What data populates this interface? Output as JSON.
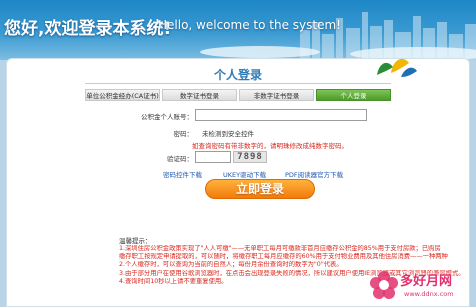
{
  "header": {
    "welcome_cn": "您好,欢迎登录本系统!",
    "welcome_en": "Hello, welcome to the system!"
  },
  "panel": {
    "title": "个人登录",
    "tabs": [
      {
        "label": "单位公积金经办(CA证书)",
        "active": false
      },
      {
        "label": "数字证书登录",
        "active": false
      },
      {
        "label": "非数字证书登录",
        "active": false
      },
      {
        "label": "个人登录",
        "active": true
      }
    ]
  },
  "form": {
    "account_label": "公积金个人账号：",
    "account_value": "",
    "password_label": "密码：",
    "password_value": "未检测到安全控件",
    "warning": "如查询密码有带非数字的，请明珠修改成纯数字密码。",
    "captcha_label": "验证码：",
    "captcha_value": "",
    "captcha_code": "7898",
    "login_button": "立即登录"
  },
  "downloads": [
    "密码控件下载",
    "UKEY驱动下载",
    "PDF阅读器官方下载"
  ],
  "tips": {
    "title": "温馨提示：",
    "lines": [
      "1.深圳住房公积金政策实现了\"人人可缴\"——无单职工每月可缴款非首月应缴存公积金的85%用于支付房款；已购房",
      "缴存职工按规定申请提取的，可以随时，将缴存职工每月应缴存的60%用于支付物业费用及其他住房消费——一种两种",
      "2.个人缴存时，可以查询为当前的自然人；每份月余份查询时的数字为\"0\"代表。",
      "3.由于部分用户在使用谷歌浏览器时，在点击会出现登录失败的情况，所以建议用户使用IE浏览器或其它浏览器的兼容模式。",
      "4.查询时间10秒以上请不要重复使用。"
    ]
  },
  "watermark": {
    "text": "多好月网",
    "url": "www.ddnx.com"
  },
  "colors": {
    "banner": "#1e87c6",
    "tab_active": "#5aa832",
    "button": "#f37a0a",
    "warning": "#d9261c",
    "link": "#1d56b5"
  }
}
